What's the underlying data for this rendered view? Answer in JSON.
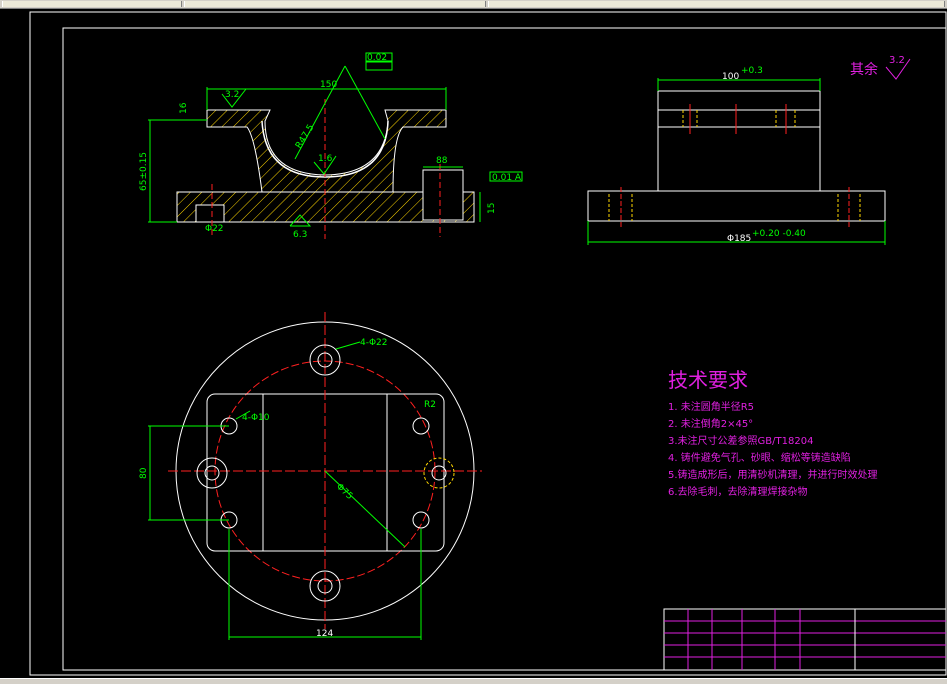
{
  "technical_requirements": {
    "title": "技术要求",
    "items": [
      "1. 未注圆角半径R5",
      "2. 未注倒角2×45°",
      "3.未注尺寸公差参照GB/T18204",
      "4. 铸件避免气孔、砂眼、缩松等铸造缺陷",
      "5.铸造成形后，用清砂机清理，并进行时效处理",
      "6.去除毛刺，去除清理焊接杂物"
    ]
  },
  "surface_finish": {
    "label": "其余",
    "value": "3.2"
  },
  "front_view": {
    "dim_top_width": "150",
    "dim_height": "65±0.15",
    "dim_base": "15",
    "dim_bore": "R47.5",
    "roughness_top": "3.2",
    "roughness_bore": "1.6",
    "roughness_bottom": "6.3",
    "dim_flange": "88",
    "dim_flange_thick": "16",
    "gdt_perp": "0.01 A",
    "gdt_flat": "0.02",
    "dim_slot": "Φ22"
  },
  "side_view": {
    "dim_top": "100",
    "dim_top_tol": "+0.3",
    "dim_base": "Φ185",
    "dim_base_tol": "+0.20 -0.40"
  },
  "plan_view": {
    "holes_large": "4-Φ22",
    "holes_small": "4-Φ10",
    "dim_124": "124",
    "dim_80": "80",
    "dim_r": "R2",
    "dim_diag": "Φ75"
  },
  "colors": {
    "outline": "#ffffff",
    "dimension": "#00ff00",
    "centerline": "#ff2020",
    "hidden": "#ffd700",
    "text": "#e020e0",
    "border": "#ffffff"
  }
}
